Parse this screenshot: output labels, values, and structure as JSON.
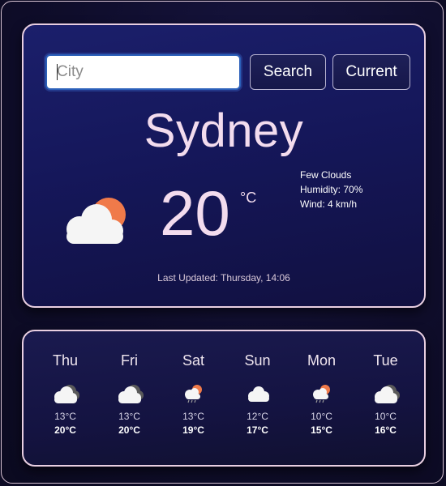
{
  "search": {
    "placeholder": "City",
    "value": "",
    "search_label": "Search",
    "current_label": "Current"
  },
  "current": {
    "city": "Sydney",
    "temperature": "20",
    "unit": "°C",
    "icon": "sun-behind-cloud-icon",
    "description": "Few Clouds",
    "humidity": "Humidity: 70%",
    "wind": "Wind: 4 km/h",
    "last_updated": "Last Updated: Thursday, 14:06"
  },
  "forecast": [
    {
      "day": "Thu",
      "icon": "cloudy-icon",
      "min": "13°C",
      "max": "20°C"
    },
    {
      "day": "Fri",
      "icon": "cloudy-icon",
      "min": "13°C",
      "max": "20°C"
    },
    {
      "day": "Sat",
      "icon": "sun-rain-cloud-icon",
      "min": "13°C",
      "max": "19°C"
    },
    {
      "day": "Sun",
      "icon": "cloud-icon",
      "min": "12°C",
      "max": "17°C"
    },
    {
      "day": "Mon",
      "icon": "sun-rain-cloud-icon",
      "min": "10°C",
      "max": "15°C"
    },
    {
      "day": "Tue",
      "icon": "cloudy-icon",
      "min": "10°C",
      "max": "16°C"
    }
  ],
  "colors": {
    "accent_sun": "#f07a4a",
    "cloud": "#f5f5f5",
    "dark_cloud": "#5a5a5a",
    "text_primary": "#f3dcee"
  }
}
